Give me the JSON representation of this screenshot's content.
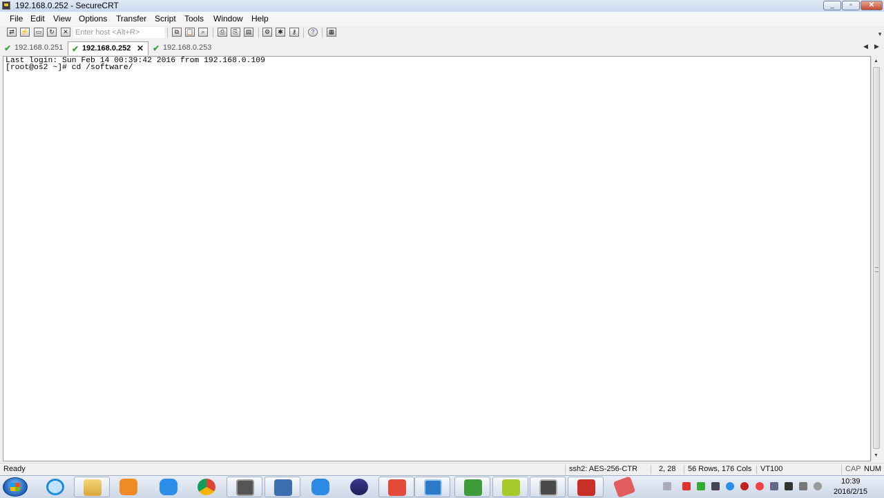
{
  "window": {
    "title": "192.168.0.252 - SecureCRT"
  },
  "menu": {
    "items": [
      "File",
      "Edit",
      "View",
      "Options",
      "Transfer",
      "Script",
      "Tools",
      "Window",
      "Help"
    ]
  },
  "toolbar": {
    "host_placeholder": "Enter host <Alt+R>"
  },
  "tabs": [
    {
      "label": "192.168.0.251",
      "active": false
    },
    {
      "label": "192.168.0.252",
      "active": true
    },
    {
      "label": "192.168.0.253",
      "active": false
    }
  ],
  "terminal": {
    "lines": [
      "Last login: Sun Feb 14 00:39:42 2016 from 192.168.0.109",
      "[root@os2 ~]# cd /software/"
    ]
  },
  "status": {
    "state": "Ready",
    "cipher": "ssh2: AES-256-CTR",
    "cursor": "2,  28",
    "size": "56 Rows, 176 Cols",
    "emulation": "VT100",
    "caps": "CAP",
    "num": "NUM"
  },
  "taskbar": {
    "time": "10:39",
    "date": "2016/2/15"
  },
  "colors": {
    "check": "#3aa53a",
    "title_bar": "#c9d9ee"
  }
}
